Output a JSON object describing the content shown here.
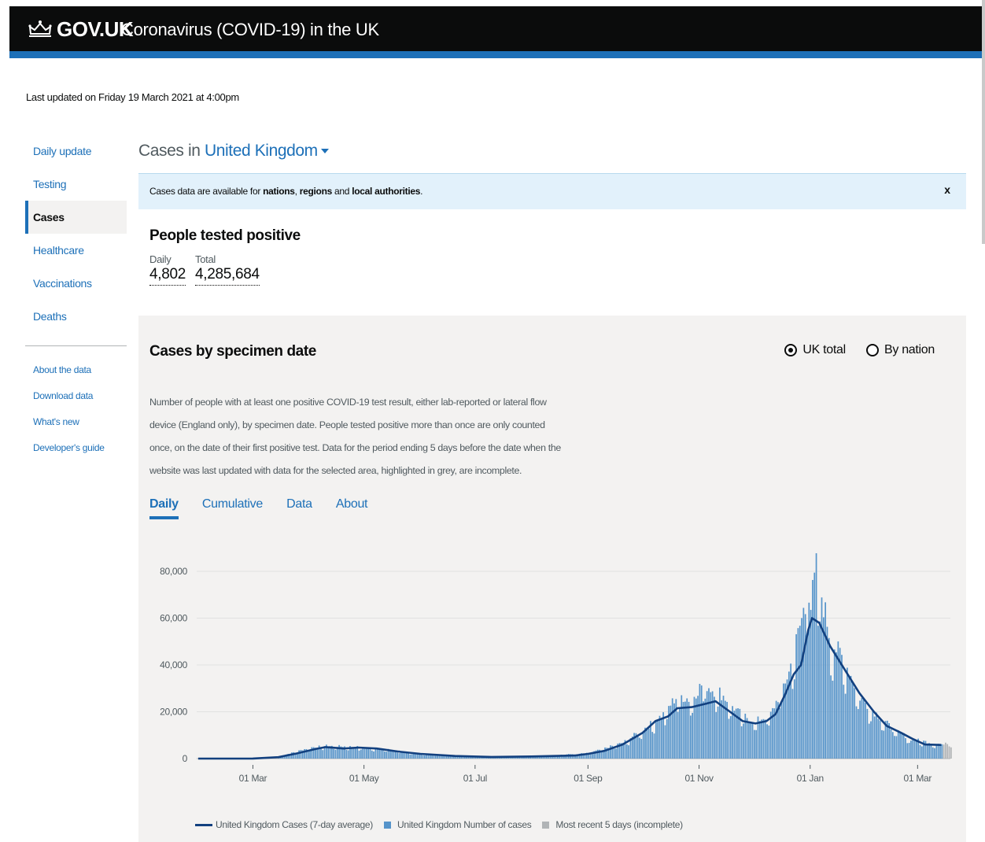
{
  "header": {
    "logo": "GOV.UK",
    "service": "Coronavirus (COVID-19) in the UK"
  },
  "last_updated": "Last updated on Friday 19 March 2021 at 4:00pm",
  "sidenav": {
    "items": [
      {
        "label": "Daily update"
      },
      {
        "label": "Testing"
      },
      {
        "label": "Cases"
      },
      {
        "label": "Healthcare"
      },
      {
        "label": "Vaccinations"
      },
      {
        "label": "Deaths"
      }
    ],
    "secondary": [
      {
        "label": "About the data"
      },
      {
        "label": "Download data"
      },
      {
        "label": "What's new"
      },
      {
        "label": "Developer's guide"
      }
    ]
  },
  "main": {
    "title_prefix": "Cases in",
    "area": "United Kingdom",
    "notice": {
      "text_before": "Cases data are available for",
      "link1": "nations",
      "sep1": ",",
      "link2": "regions",
      "sep2": "and",
      "link3": "local authorities",
      "end": ".",
      "close": "x"
    },
    "headline": {
      "title": "People tested positive",
      "daily_label": "Daily",
      "daily_value": "4,802",
      "total_label": "Total",
      "total_value": "4,285,684"
    },
    "card": {
      "title": "Cases by specimen date",
      "radio_uk": "UK total",
      "radio_nation": "By nation",
      "description": "Number of people with at least one positive COVID-19 test result, either lab-reported or lateral flow device (England only), by specimen date. People tested positive more than once are only counted once, on the date of their first positive test. Data for the period ending 5 days before the date when the website was last updated with data for the selected area, highlighted in grey, are incomplete.",
      "tabs": [
        "Daily",
        "Cumulative",
        "Data",
        "About"
      ]
    },
    "legend": {
      "line": "United Kingdom Cases (7-day average)",
      "bars": "United Kingdom Number of cases",
      "incomplete": "Most recent 5 days (incomplete)"
    }
  },
  "colors": {
    "header_bg": "#0b0c0c",
    "brand_blue": "#1d70b8",
    "bar_blue": "#5694ca",
    "line_dark": "#12407f",
    "incomplete_grey": "#b1b4b6"
  },
  "chart_data": {
    "type": "bar",
    "ylim": [
      0,
      80000
    ],
    "yticks": [
      "80,000",
      "60,000",
      "40,000",
      "20,000",
      "0"
    ],
    "ytick_values": [
      80000,
      60000,
      40000,
      20000,
      0
    ],
    "xtick_labels": [
      "01 Mar",
      "01 May",
      "01 Jul",
      "01 Sep",
      "01 Nov",
      "01 Jan",
      "01 Mar"
    ],
    "x_range": [
      "2020-01-31",
      "2021-03-19"
    ],
    "series": [
      {
        "name": "United Kingdom Cases (7-day average)",
        "kind": "line",
        "points": [
          [
            "2020-01-31",
            0
          ],
          [
            "2020-03-01",
            50
          ],
          [
            "2020-03-15",
            600
          ],
          [
            "2020-03-25",
            2200
          ],
          [
            "2020-04-05",
            4200
          ],
          [
            "2020-04-10",
            4900
          ],
          [
            "2020-04-20",
            4300
          ],
          [
            "2020-04-28",
            4700
          ],
          [
            "2020-05-08",
            4300
          ],
          [
            "2020-05-20",
            3000
          ],
          [
            "2020-06-01",
            2000
          ],
          [
            "2020-06-20",
            1100
          ],
          [
            "2020-07-10",
            700
          ],
          [
            "2020-08-01",
            900
          ],
          [
            "2020-08-25",
            1300
          ],
          [
            "2020-09-01",
            2000
          ],
          [
            "2020-09-10",
            3300
          ],
          [
            "2020-09-20",
            6000
          ],
          [
            "2020-10-01",
            11000
          ],
          [
            "2020-10-08",
            16000
          ],
          [
            "2020-10-15",
            18000
          ],
          [
            "2020-10-20",
            21500
          ],
          [
            "2020-10-28",
            22000
          ],
          [
            "2020-11-05",
            23500
          ],
          [
            "2020-11-10",
            24500
          ],
          [
            "2020-11-18",
            20000
          ],
          [
            "2020-11-25",
            16000
          ],
          [
            "2020-12-02",
            15000
          ],
          [
            "2020-12-08",
            16000
          ],
          [
            "2020-12-13",
            19000
          ],
          [
            "2020-12-18",
            27000
          ],
          [
            "2020-12-23",
            36000
          ],
          [
            "2020-12-27",
            40000
          ],
          [
            "2020-12-31",
            55000
          ],
          [
            "2021-01-02",
            60000
          ],
          [
            "2021-01-06",
            58000
          ],
          [
            "2021-01-12",
            48000
          ],
          [
            "2021-01-20",
            38000
          ],
          [
            "2021-01-28",
            28000
          ],
          [
            "2021-02-05",
            20000
          ],
          [
            "2021-02-12",
            14000
          ],
          [
            "2021-02-20",
            11000
          ],
          [
            "2021-02-26",
            8500
          ],
          [
            "2021-03-05",
            6000
          ],
          [
            "2021-03-14",
            5800
          ]
        ]
      },
      {
        "name": "United Kingdom Number of cases",
        "kind": "bar",
        "points": [
          [
            "2020-03-15",
            800
          ],
          [
            "2020-04-01",
            4500
          ],
          [
            "2020-04-10",
            5200
          ],
          [
            "2020-04-25",
            4800
          ],
          [
            "2020-05-10",
            4000
          ],
          [
            "2020-06-01",
            1800
          ],
          [
            "2020-07-01",
            700
          ],
          [
            "2020-08-01",
            900
          ],
          [
            "2020-09-01",
            2200
          ],
          [
            "2020-09-20",
            6500
          ],
          [
            "2020-10-05",
            14000
          ],
          [
            "2020-10-12",
            18000
          ],
          [
            "2020-10-20",
            26000
          ],
          [
            "2020-10-27",
            24000
          ],
          [
            "2020-11-03",
            31000
          ],
          [
            "2020-11-08",
            28000
          ],
          [
            "2020-11-12",
            27000
          ],
          [
            "2020-11-22",
            19000
          ],
          [
            "2020-12-01",
            15000
          ],
          [
            "2020-12-10",
            18000
          ],
          [
            "2020-12-20",
            35000
          ],
          [
            "2020-12-28",
            60000
          ],
          [
            "2020-12-29",
            81000
          ],
          [
            "2021-01-01",
            62000
          ],
          [
            "2021-01-04",
            77000
          ],
          [
            "2021-01-06",
            70000
          ],
          [
            "2021-01-12",
            48000
          ],
          [
            "2021-01-20",
            39000
          ],
          [
            "2021-01-28",
            25000
          ],
          [
            "2021-02-05",
            19000
          ],
          [
            "2021-02-15",
            12000
          ],
          [
            "2021-02-25",
            8000
          ],
          [
            "2021-03-08",
            6500
          ],
          [
            "2021-03-14",
            5800
          ]
        ]
      },
      {
        "name": "Most recent 5 days (incomplete)",
        "kind": "bar",
        "points": [
          [
            "2021-03-15",
            6000
          ],
          [
            "2021-03-16",
            6800
          ],
          [
            "2021-03-17",
            6200
          ],
          [
            "2021-03-18",
            5200
          ],
          [
            "2021-03-19",
            4800
          ]
        ]
      }
    ]
  }
}
